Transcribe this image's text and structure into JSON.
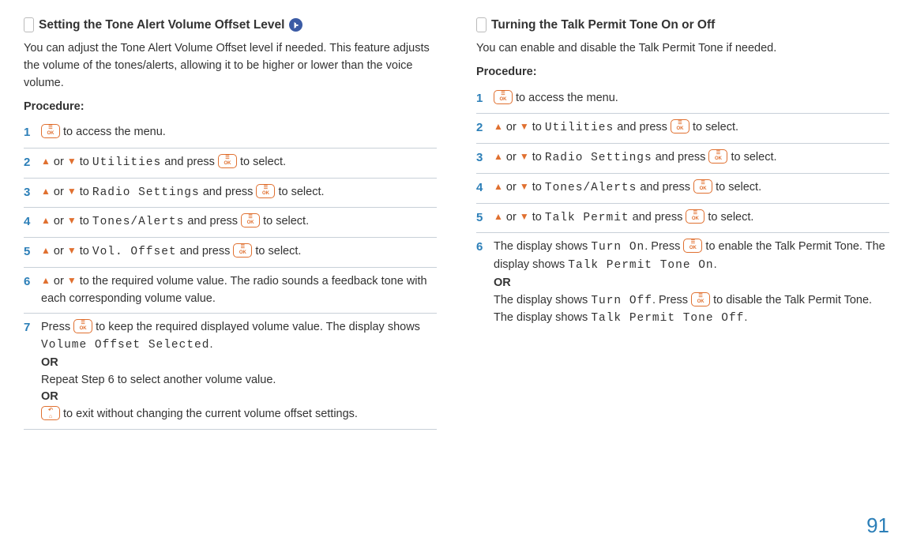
{
  "page_number": "91",
  "left": {
    "title": "Setting the Tone Alert Volume Offset Level",
    "intro": "You can adjust the Tone Alert Volume Offset level if needed. This feature adjusts the volume of the tones/alerts, allowing it to be higher or lower than the voice volume.",
    "procedure_label": "Procedure:",
    "steps": [
      {
        "n": "1",
        "t1": " to access the menu."
      },
      {
        "n": "2",
        "or": " or ",
        "to": " to ",
        "menu": "Utilities",
        "andpress": " and press ",
        "tosel": " to select."
      },
      {
        "n": "3",
        "or": " or ",
        "to": " to ",
        "menu": "Radio Settings",
        "andpress": " and press ",
        "tosel": " to select."
      },
      {
        "n": "4",
        "or": " or ",
        "to": " to ",
        "menu": "Tones/Alerts",
        "andpress": " and press ",
        "tosel": " to select."
      },
      {
        "n": "5",
        "or": " or ",
        "to": " to ",
        "menu": "Vol. Offset",
        "andpress": " and press ",
        "tosel": " to select."
      },
      {
        "n": "6",
        "or": " or ",
        "tail": " to the required volume value. The radio sounds a feedback tone with each corresponding volume value."
      },
      {
        "n": "7",
        "a": "Press ",
        "b": " to keep the required displayed volume value. The display shows ",
        "c": "Volume Offset Selected",
        "d": ".",
        "or1": "OR",
        "e": "Repeat Step 6 to select another volume value.",
        "or2": "OR",
        "f": " to exit without changing the current volume offset settings."
      }
    ]
  },
  "right": {
    "title": "Turning the Talk Permit Tone On or Off",
    "intro": "You can enable and disable the Talk Permit Tone if needed.",
    "procedure_label": "Procedure:",
    "steps": [
      {
        "n": "1",
        "t1": " to access the menu."
      },
      {
        "n": "2",
        "or": " or ",
        "to": " to ",
        "menu": "Utilities",
        "andpress": " and press ",
        "tosel": " to select."
      },
      {
        "n": "3",
        "or": " or ",
        "to": " to ",
        "menu": "Radio Settings",
        "andpress": " and press ",
        "tosel": " to select."
      },
      {
        "n": "4",
        "or": " or ",
        "to": " to ",
        "menu": "Tones/Alerts",
        "andpress": " and press ",
        "tosel": " to select."
      },
      {
        "n": "5",
        "or": " or ",
        "to": " to ",
        "menu": "Talk Permit",
        "andpress": " and press ",
        "tosel": " to select."
      },
      {
        "n": "6",
        "a": "The display shows ",
        "b": "Turn On",
        "c": ". Press ",
        "d": " to enable the Talk Permit Tone. The display shows ",
        "e": "Talk Permit Tone On",
        "f": ".",
        "or1": "OR",
        "g": "The display shows ",
        "h": "Turn Off",
        "i": ". Press ",
        "j": " to disable the Talk Permit Tone. The display shows ",
        "k": "Talk Permit Tone Off",
        "l": "."
      }
    ]
  }
}
